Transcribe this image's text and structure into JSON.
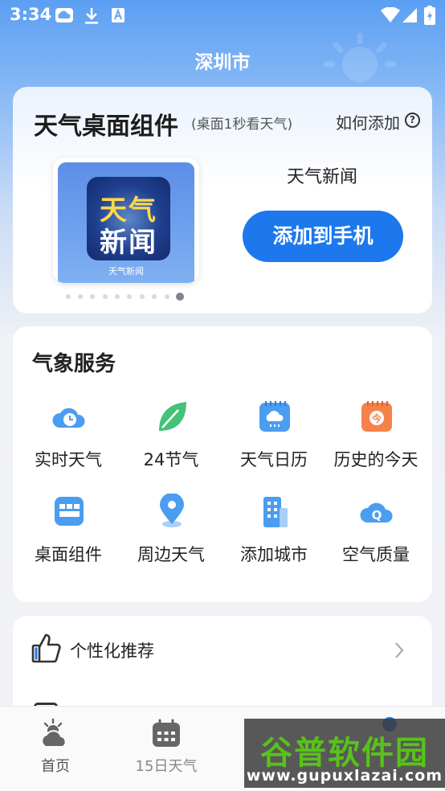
{
  "status_bar": {
    "time": "3:34"
  },
  "header": {
    "city": "深圳市"
  },
  "widget_card": {
    "title": "天气桌面组件",
    "subtitle": "(桌面1秒看天气)",
    "how_to_add": "如何添加",
    "help_symbol": "?",
    "preview": {
      "line1": "天气",
      "line2": "新闻",
      "caption": "天气新闻"
    },
    "widget_name": "天气新闻",
    "add_button": "添加到手机",
    "pager": {
      "pages": 10,
      "current": 10
    }
  },
  "services": {
    "title": "气象服务",
    "items": [
      {
        "label": "实时天气",
        "icon": "cloud-clock-icon"
      },
      {
        "label": "24节气",
        "icon": "leaf-icon"
      },
      {
        "label": "天气日历",
        "icon": "calendar-rain-icon"
      },
      {
        "label": "历史的今天",
        "icon": "calendar-today-icon"
      },
      {
        "label": "桌面组件",
        "icon": "widget-grid-icon"
      },
      {
        "label": "周边天气",
        "icon": "location-pin-icon"
      },
      {
        "label": "添加城市",
        "icon": "building-icon"
      },
      {
        "label": "空气质量",
        "icon": "cloud-q-icon"
      }
    ],
    "calendar_today_glyph": "今",
    "air_quality_glyph": "Q"
  },
  "recommendation": {
    "label": "个性化推荐"
  },
  "bottom_nav": {
    "items": [
      {
        "label": "首页",
        "icon": "home-weather-icon"
      },
      {
        "label": "15日天气",
        "icon": "calendar-icon"
      },
      {
        "label": "",
        "icon": ""
      },
      {
        "label": "",
        "icon": "profile-icon"
      }
    ]
  },
  "watermark": {
    "text": "谷普软件园",
    "url": "www.gupuxlazai.com"
  },
  "colors": {
    "accent": "#1c78ec",
    "header_blue": "#5b9ff3",
    "service_blue": "#4a9df0",
    "service_green": "#43c27a",
    "service_orange": "#f6824a"
  }
}
